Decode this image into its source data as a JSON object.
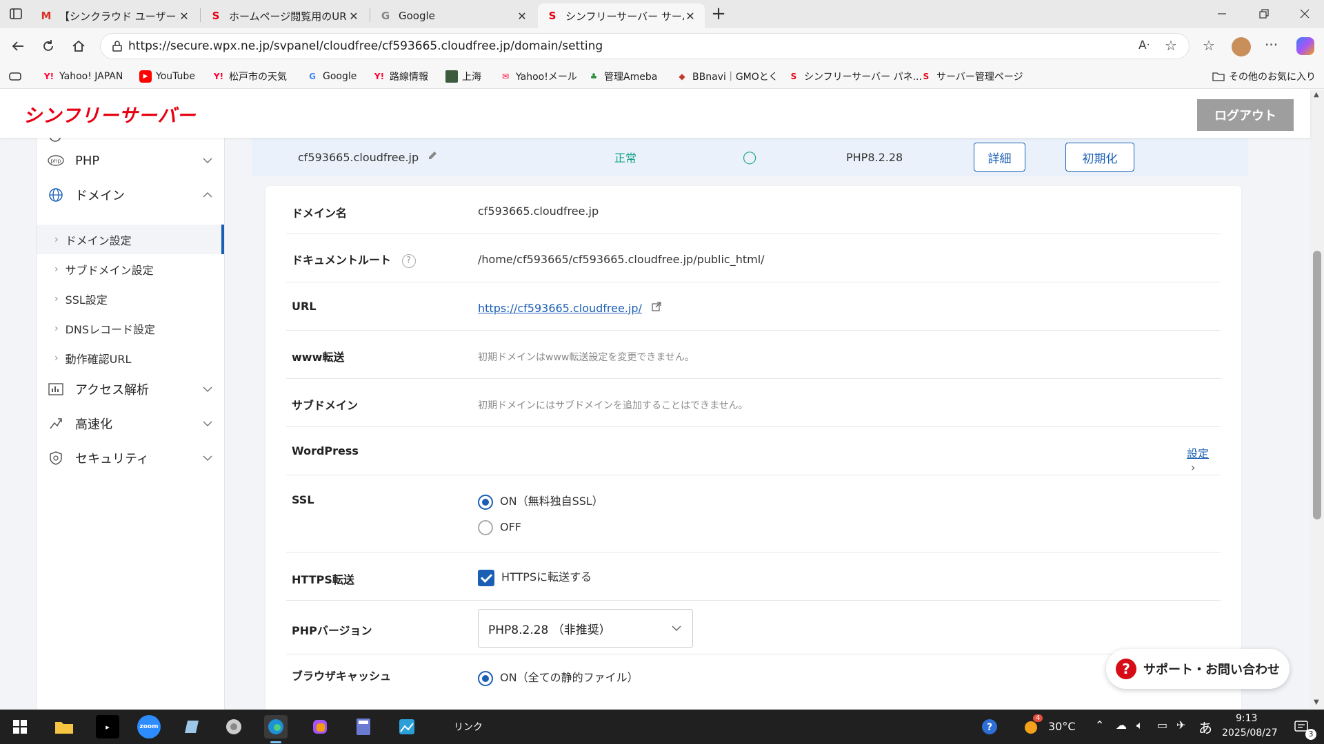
{
  "browser": {
    "tabs": [
      {
        "title": "【シンクラウド ユーザーコミュニティ】質問",
        "icon": "gmail-icon",
        "active": false
      },
      {
        "title": "ホームページ閲覧用のURLが分からない",
        "icon": "sinfree-icon",
        "active": false
      },
      {
        "title": "Google",
        "icon": "google-icon",
        "active": false
      },
      {
        "title": "シンフリーサーバー サーバーパネル - ドメ",
        "icon": "sinfree-icon",
        "active": true
      }
    ],
    "url": "https://secure.wpx.ne.jp/svpanel/cloudfree/cf593665.cloudfree.jp/domain/setting",
    "bookmarks": [
      {
        "label": "Yahoo! JAPAN",
        "icon": "yahoo-icon"
      },
      {
        "label": "YouTube",
        "icon": "youtube-icon"
      },
      {
        "label": "松戸市の天気",
        "icon": "yahoo-icon"
      },
      {
        "label": "Google",
        "icon": "google-icon"
      },
      {
        "label": "路線情報",
        "icon": "yahoo-icon"
      },
      {
        "label": "上海",
        "icon": "image-icon"
      },
      {
        "label": "Yahoo!メール",
        "icon": "yahoo-mail-icon"
      },
      {
        "label": "管理Ameba",
        "icon": "ameba-icon"
      },
      {
        "label": "BBnavi｜GMOとく",
        "icon": "bbnavi-icon"
      },
      {
        "label": "シンフリーサーバー パネ...",
        "icon": "sinfree-icon"
      },
      {
        "label": "サーバー管理ページ",
        "icon": "sinfree-icon"
      }
    ],
    "other_bookmarks": "その他のお気に入り"
  },
  "site": {
    "logo": "シンフリーサーバー",
    "logout": "ログアウト"
  },
  "sidebar": {
    "categories": [
      {
        "label": "PHP",
        "icon": "php-icon"
      },
      {
        "label": "ドメイン",
        "icon": "globe-icon"
      },
      {
        "label": "アクセス解析",
        "icon": "bar-chart-icon"
      },
      {
        "label": "高速化",
        "icon": "speed-icon"
      },
      {
        "label": "セキュリティ",
        "icon": "shield-icon"
      }
    ],
    "domain_items": [
      {
        "label": "ドメイン設定"
      },
      {
        "label": "サブドメイン設定"
      },
      {
        "label": "SSL設定"
      },
      {
        "label": "DNSレコード設定"
      },
      {
        "label": "動作確認URL"
      }
    ]
  },
  "summary": {
    "domain": "cf593665.cloudfree.jp",
    "status": "正常",
    "ssl_mark": "◯",
    "php": "PHP8.2.28",
    "detail_btn": "詳細",
    "reset_btn": "初期化"
  },
  "settings": {
    "domain_name": {
      "label": "ドメイン名",
      "value": "cf593665.cloudfree.jp"
    },
    "doc_root": {
      "label": "ドキュメントルート",
      "value": "/home/cf593665/cf593665.cloudfree.jp/public_html/"
    },
    "url": {
      "label": "URL",
      "value": "https://cf593665.cloudfree.jp/"
    },
    "www": {
      "label": "www転送",
      "note": "初期ドメインはwww転送設定を変更できません。"
    },
    "subdomain": {
      "label": "サブドメイン",
      "note": "初期ドメインにはサブドメインを追加することはできません。"
    },
    "wordpress": {
      "label": "WordPress",
      "action": "設定"
    },
    "ssl": {
      "label": "SSL",
      "on": "ON（無料独自SSL）",
      "off": "OFF"
    },
    "https": {
      "label": "HTTPS転送",
      "option": "HTTPSに転送する"
    },
    "php": {
      "label": "PHPバージョン",
      "selected": "PHP8.2.28 （非推奨）"
    },
    "cache": {
      "label": "ブラウザキャッシュ",
      "on": "ON（全ての静的ファイル）"
    }
  },
  "support": "サポート・お問い合わせ",
  "taskbar": {
    "link_label": "リンク",
    "temp": "30°C",
    "weather_badge": "4",
    "ime": "あ",
    "time": "9:13",
    "date": "2025/08/27",
    "notif": "3"
  },
  "colors": {
    "accent": "#1a5fb4",
    "brand": "#e60012",
    "status_ok": "#19a38a"
  }
}
